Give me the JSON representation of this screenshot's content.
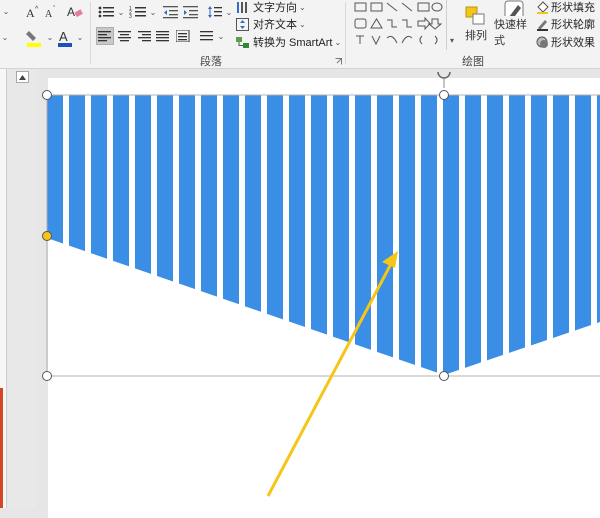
{
  "ribbon": {
    "paragraph_group_label": "段落",
    "drawing_group_label": "绘图",
    "text_direction_label": "文字方向",
    "align_text_label": "对齐文本",
    "convert_smartart_label": "转换为 SmartArt",
    "arrange_label": "排列",
    "quick_styles_label": "快速样式",
    "shape_fill_label": "形状填充",
    "shape_outline_label": "形状轮廓",
    "shape_effects_label": "形状效果"
  },
  "colors": {
    "stripe_blue": "#3a8ee6",
    "selection_handle": "#ffffff",
    "adjust_handle": "#f5c518",
    "arrow": "#f5c518",
    "accent_red": "#d24726"
  },
  "icons": {
    "grow_font": "font-grow-icon",
    "shrink_font": "font-shrink-icon",
    "clear_format": "clear-format-icon",
    "highlight": "highlight-icon",
    "font_color": "font-color-icon",
    "bullets": "bullets-icon",
    "numbering": "numbering-icon",
    "line_spacing": "line-spacing-icon",
    "shapes_gallery": "shapes-gallery-icon"
  }
}
